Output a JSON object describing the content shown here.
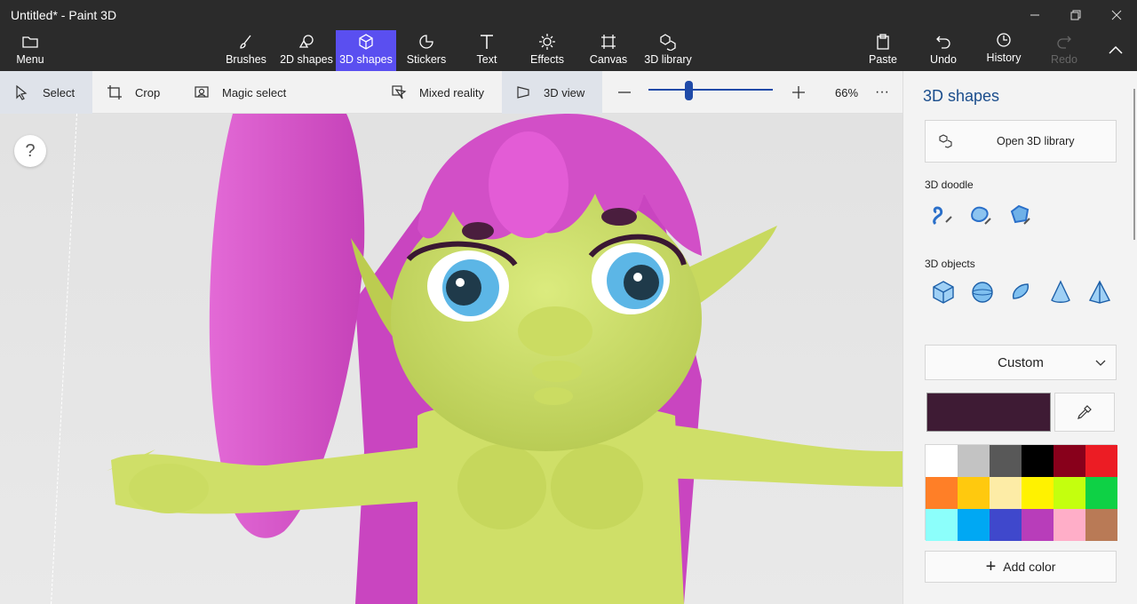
{
  "window": {
    "title": "Untitled* - Paint 3D"
  },
  "ribbon": {
    "menu": "Menu",
    "tools": [
      {
        "label": "Brushes",
        "icon": "brush-icon"
      },
      {
        "label": "2D shapes",
        "icon": "2d-shapes-icon"
      },
      {
        "label": "3D shapes",
        "icon": "3d-shapes-icon",
        "active": true
      },
      {
        "label": "Stickers",
        "icon": "stickers-icon"
      },
      {
        "label": "Text",
        "icon": "text-icon"
      },
      {
        "label": "Effects",
        "icon": "effects-icon"
      },
      {
        "label": "Canvas",
        "icon": "canvas-icon"
      },
      {
        "label": "3D library",
        "icon": "3d-library-icon"
      }
    ],
    "paste": "Paste",
    "undo": "Undo",
    "history": "History",
    "redo": "Redo"
  },
  "subbar": {
    "select": "Select",
    "crop": "Crop",
    "magic_select": "Magic select",
    "mixed_reality": "Mixed reality",
    "view": "3D view",
    "zoom_level": "66%",
    "zoom_value": 0.32,
    "more": "···"
  },
  "canvas": {
    "help": "?"
  },
  "panel": {
    "title": "3D shapes",
    "open_library": "Open 3D library",
    "doodle_label": "3D doodle",
    "objects_label": "3D objects",
    "material": "Custom",
    "selected_color": "#3e1b34",
    "palette": [
      "#ffffff",
      "#c3c3c3",
      "#585858",
      "#000000",
      "#88001b",
      "#ec1c24",
      "#ff7f27",
      "#ffc90e",
      "#fdeca6",
      "#fff200",
      "#c4ff0e",
      "#0ed145",
      "#8cfffb",
      "#00a8f3",
      "#3f48cc",
      "#b83dba",
      "#ffaec8",
      "#b97a56"
    ],
    "add_color": "Add color"
  }
}
